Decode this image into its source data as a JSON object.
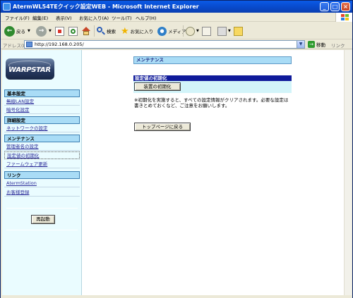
{
  "window": {
    "title": "AtermWL54TEクイック設定WEB - Microsoft Internet Explorer"
  },
  "menu": [
    "ファイル(F)",
    "編集(E)",
    "表示(V)",
    "お気に入り(A)",
    "ツール(T)",
    "ヘルプ(H)"
  ],
  "toolbar": {
    "back": "戻る",
    "search": "検索",
    "favorites": "お気に入り",
    "media": "メディア"
  },
  "address": {
    "label": "アドレス(D)",
    "url": "http://192.168.0.205/",
    "go": "移動",
    "links": "リンク"
  },
  "logo": {
    "text": "WARPSTAR"
  },
  "nav": {
    "sections": [
      {
        "title": "基本設定",
        "items": [
          "無線LAN設定",
          "暗号化設定"
        ]
      },
      {
        "title": "詳細設定",
        "items": [
          "ネットワークの設定"
        ]
      },
      {
        "title": "メンテナンス",
        "items": [
          "管理者名の設定",
          "設定値の初期化",
          "ファームウェア更新"
        ]
      },
      {
        "title": "リンク",
        "items": [
          "AtermStation",
          "お客様登録"
        ]
      }
    ],
    "reboot": "再起動"
  },
  "main": {
    "title": "メンテナンス",
    "section_title": "設定値の初期化",
    "init_button": "装置の初期化",
    "description": "※初期化を実施すると、すべての設定情報がクリアされます。必要な設定は書きとめておくなど、ご注意をお願いします。",
    "top_button": "トップページに戻る"
  },
  "colors": {
    "nav_header_bg": "#a9dcf6",
    "section_title_bg": "#0f1a9a",
    "panel_bg": "#d2f4f9",
    "left_frame_bg": "#eafcff"
  }
}
